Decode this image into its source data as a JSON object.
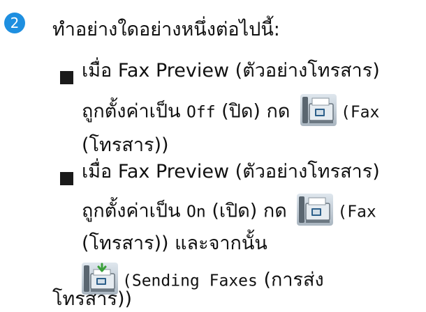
{
  "step": {
    "number": "2",
    "intro": "ทำอย่างใดอย่างหนึ่งต่อไปนี้:"
  },
  "items": [
    {
      "line1": "เมื่อ Fax Preview (ตัวอย่างโทรสาร)",
      "line2_prefix": "ถูกตั้งค่าเป็น ",
      "line2_mono": "Off",
      "line2_suffix": " (ปิด) กด ",
      "button_code": "(Fax",
      "line3": "(โทรสาร))"
    },
    {
      "line1": "เมื่อ Fax Preview (ตัวอย่างโทรสาร)",
      "line2_prefix": "ถูกตั้งค่าเป็น ",
      "line2_mono": "On",
      "line2_suffix": " (เปิด) กด ",
      "button_code": "(Fax",
      "line3": "(โทรสาร)) และจากนั้น",
      "line4_code": "(Sending Faxes",
      "line4_text": " (การส่ง",
      "line5": "โทรสาร))"
    }
  ],
  "icons": {
    "fax_button": "fax-button-icon",
    "sending_faxes_button": "sending-faxes-button-icon"
  },
  "colors": {
    "step_badge": "#1e8fe0"
  }
}
